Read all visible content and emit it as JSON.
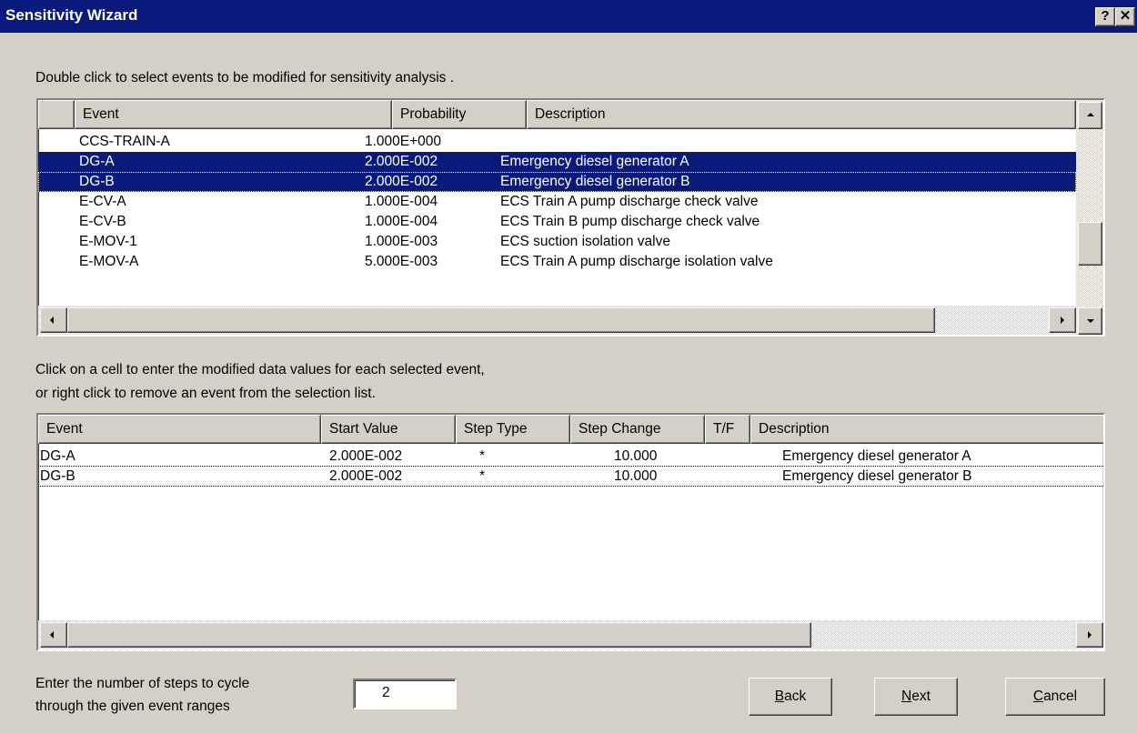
{
  "window": {
    "title": "Sensitivity Wizard",
    "help_glyph": "?",
    "close_glyph": "✕"
  },
  "instructions": {
    "top": "Double click to select events to be modified for sensitivity analysis .",
    "middle_line1": "Click on a cell to enter the modified data values for each selected event,",
    "middle_line2": " or right click to remove an event from the selection list.",
    "steps_line1": "Enter the number of steps to cycle",
    "steps_line2": "through the given event ranges"
  },
  "events_table": {
    "headers": {
      "event": "Event",
      "probability": "Probability",
      "description": "Description"
    },
    "rows": [
      {
        "event": "CCS-TRAIN-A",
        "probability": "1.000E+000",
        "description": ""
      },
      {
        "event": "DG-A",
        "probability": "2.000E-002",
        "description": "Emergency diesel generator A"
      },
      {
        "event": "DG-B",
        "probability": "2.000E-002",
        "description": "Emergency diesel generator B"
      },
      {
        "event": "E-CV-A",
        "probability": "1.000E-004",
        "description": "ECS Train A pump discharge check valve"
      },
      {
        "event": "E-CV-B",
        "probability": "1.000E-004",
        "description": "ECS Train B pump discharge check valve"
      },
      {
        "event": "E-MOV-1",
        "probability": "1.000E-003",
        "description": "ECS suction isolation valve"
      },
      {
        "event": "E-MOV-A",
        "probability": "5.000E-003",
        "description": "ECS Train A pump discharge isolation valve"
      }
    ]
  },
  "selected_table": {
    "headers": {
      "event": "Event",
      "start_value": "Start Value",
      "step_type": "Step Type",
      "step_change": "Step Change",
      "tf": "T/F",
      "description": "Description"
    },
    "rows": [
      {
        "event": "DG-A",
        "start_value": "2.000E-002",
        "step_type": "*",
        "step_change": "10.000",
        "tf": "",
        "description": "Emergency diesel generator A"
      },
      {
        "event": "DG-B",
        "start_value": "2.000E-002",
        "step_type": "*",
        "step_change": "10.000",
        "tf": "",
        "description": "Emergency diesel generator B"
      }
    ]
  },
  "steps_value": "2",
  "buttons": {
    "back_mnemonic": "B",
    "back_rest": "ack",
    "next_mnemonic": "N",
    "next_rest": "ext",
    "cancel_mnemonic": "C",
    "cancel_rest": "ancel"
  },
  "colors": {
    "title_bar": "#0a1a7a",
    "selection": "#0a1a7a",
    "face": "#d4d0c8"
  }
}
